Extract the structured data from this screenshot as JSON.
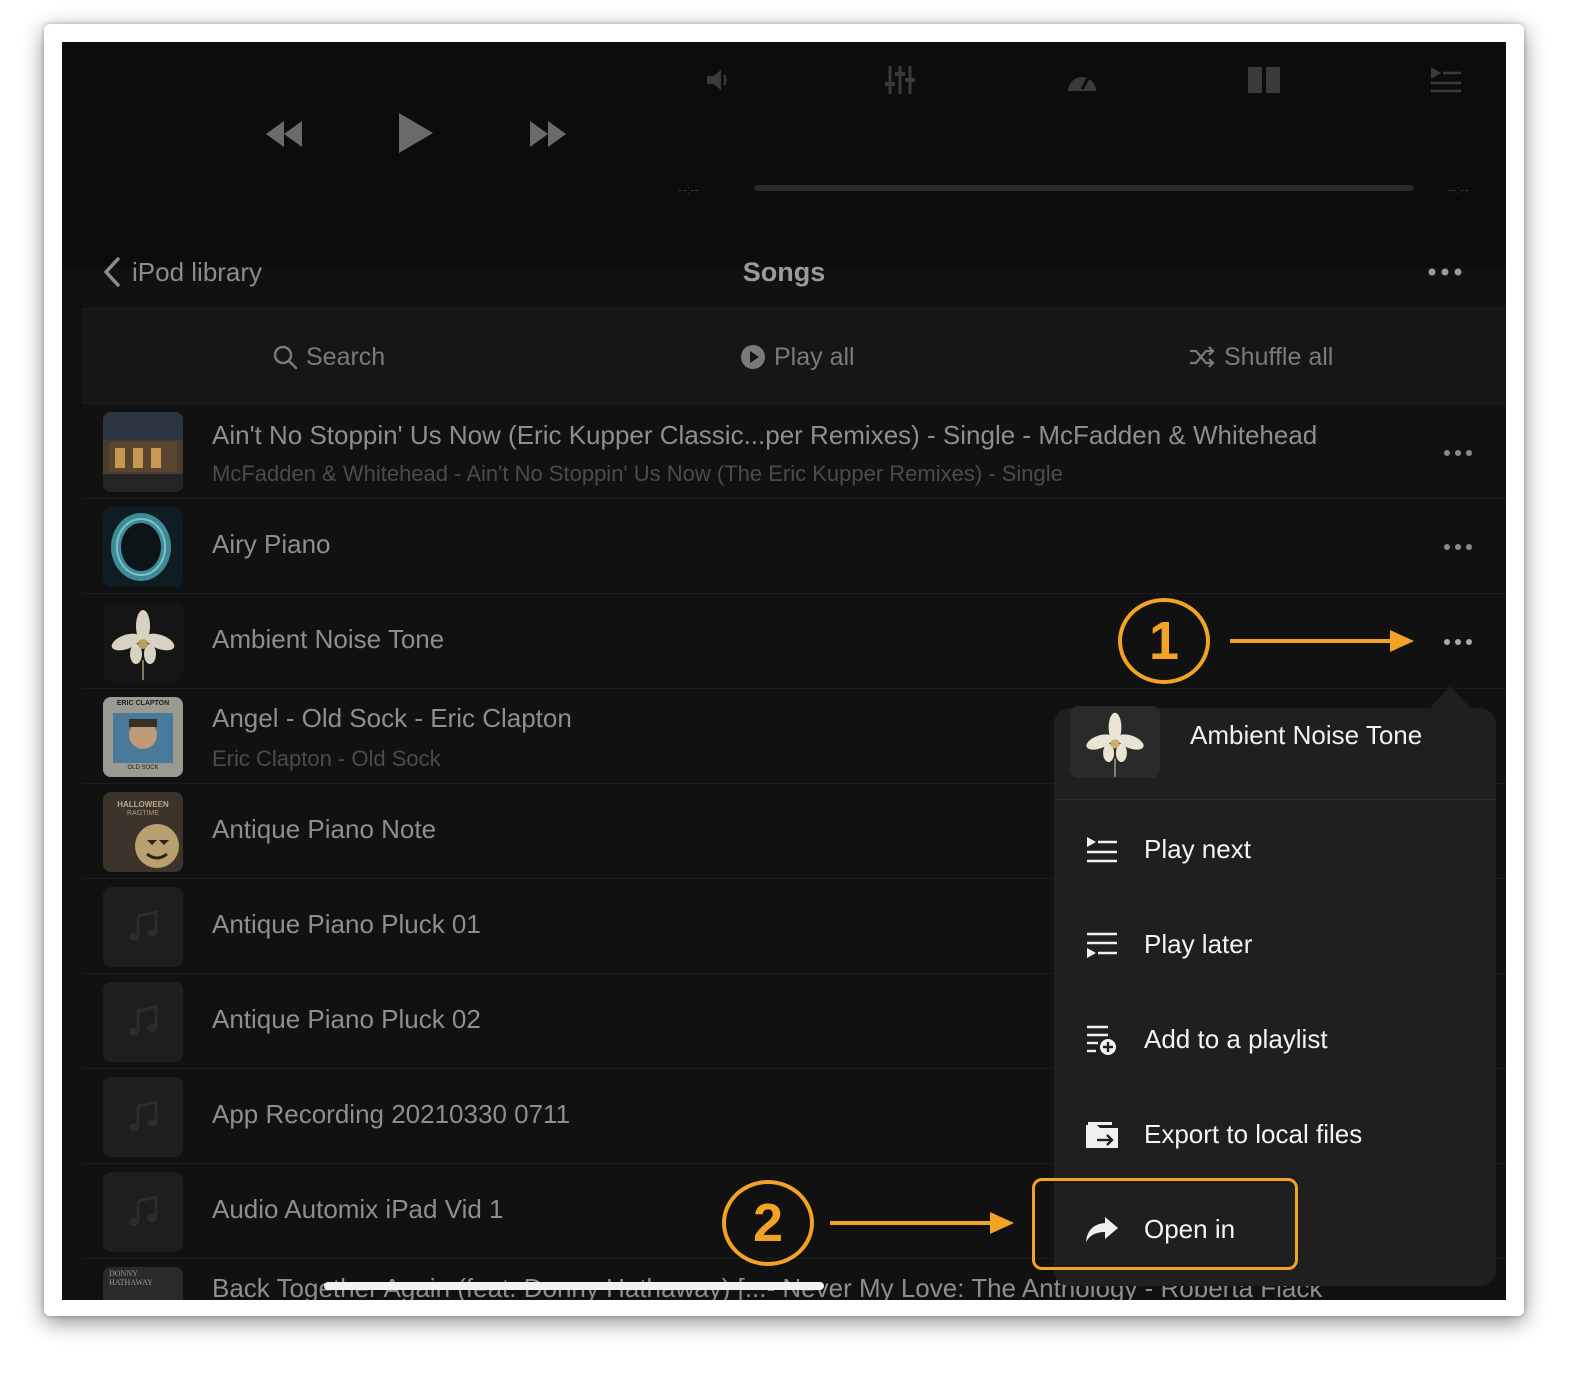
{
  "annotation_color": "#f2a324",
  "player": {
    "elapsed": "--:--",
    "remaining": "--:--",
    "controls": [
      "rewind-icon",
      "play-icon",
      "fast-forward-icon"
    ],
    "toolbar_icons": [
      "speaker-icon",
      "equalizer-icon",
      "speedometer-icon",
      "split-view-icon",
      "queue-icon"
    ]
  },
  "nav": {
    "back_label": "iPod library",
    "title": "Songs"
  },
  "actions": {
    "search": "Search",
    "play_all": "Play all",
    "shuffle_all": "Shuffle all"
  },
  "songs": [
    {
      "title": "Ain't No Stoppin' Us Now (Eric Kupper Classic...per Remixes) - Single - McFadden & Whitehead",
      "subtitle": "McFadden & Whitehead - Ain't No Stoppin' Us Now (The Eric Kupper Remixes) - Single"
    },
    {
      "title": "Airy Piano",
      "subtitle": ""
    },
    {
      "title": "Ambient Noise Tone",
      "subtitle": ""
    },
    {
      "title": "Angel - Old Sock - Eric Clapton",
      "subtitle": "Eric Clapton - Old Sock"
    },
    {
      "title": "Antique Piano Note",
      "subtitle": ""
    },
    {
      "title": "Antique Piano Pluck 01",
      "subtitle": ""
    },
    {
      "title": "Antique Piano Pluck 02",
      "subtitle": ""
    },
    {
      "title": "App Recording 20210330 0711",
      "subtitle": ""
    },
    {
      "title": "Audio Automix iPad Vid 1",
      "subtitle": ""
    },
    {
      "title": "Back Together Again (feat. Donny Hathaway) [...- Never My Love: The Anthology - Roberta Flack",
      "subtitle": ""
    }
  ],
  "album_art_text": {
    "angel": [
      "ERIC CLAPTON",
      "OLD SOCK"
    ],
    "antique_note": [
      "HALLOWEEN",
      "RAGTIME"
    ],
    "back_together": [
      "DONNY",
      "HATHAWAY"
    ]
  },
  "menu": {
    "title": "Ambient Noise Tone",
    "items": [
      {
        "label": "Play next",
        "icon": "play-next-icon"
      },
      {
        "label": "Play later",
        "icon": "play-later-icon"
      },
      {
        "label": "Add to a playlist",
        "icon": "add-playlist-icon"
      },
      {
        "label": "Export to local files",
        "icon": "export-folder-icon"
      },
      {
        "label": "Open in",
        "icon": "share-arrow-icon"
      }
    ]
  },
  "annotations": {
    "step1": "1",
    "step2": "2"
  }
}
